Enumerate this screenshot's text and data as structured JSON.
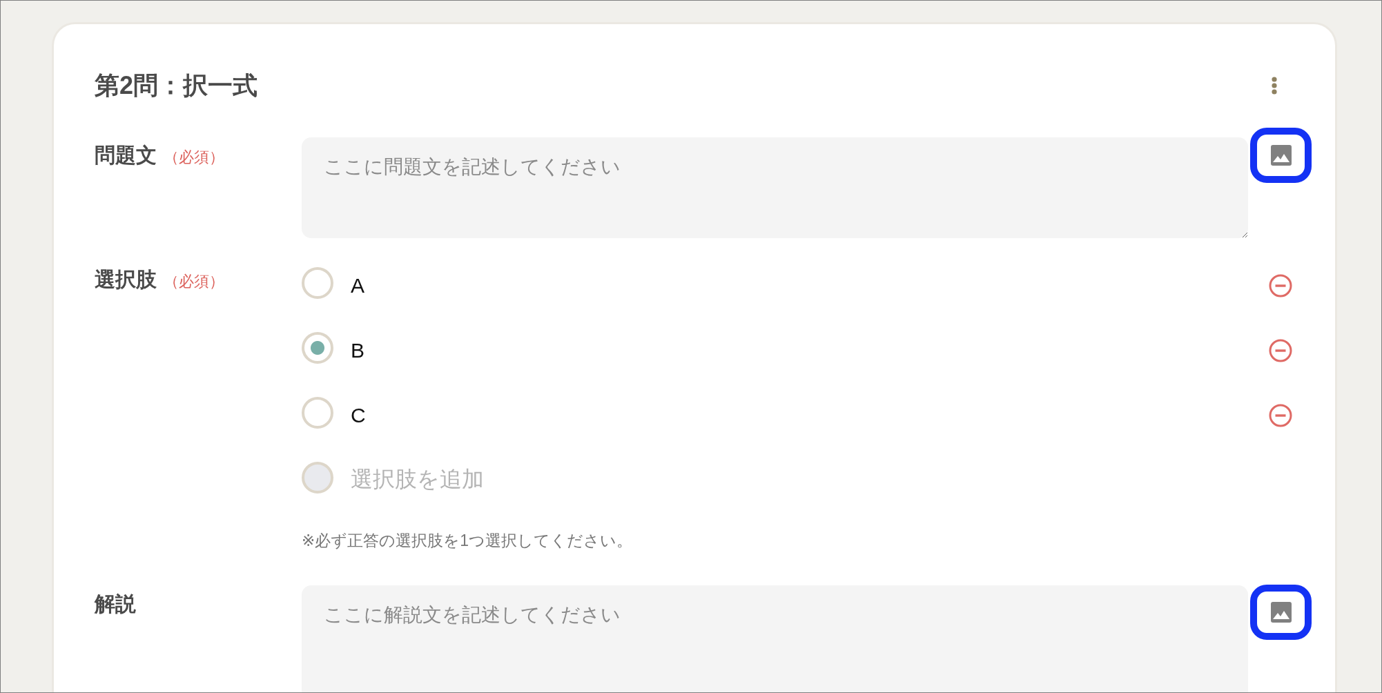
{
  "question": {
    "title": "第2問：択一式"
  },
  "sections": [
    {
      "kind": "text",
      "label": "問題文",
      "required_mark": "（必須）",
      "placeholder": "ここに問題文を記述してください"
    },
    {
      "kind": "choices",
      "label": "選択肢",
      "required_mark": "（必須）",
      "options": [
        {
          "label": "A",
          "selected": false
        },
        {
          "label": "B",
          "selected": true
        },
        {
          "label": "C",
          "selected": false
        }
      ],
      "add_option": "選択肢を追加",
      "note": "※必ず正答の選択肢を1つ選択してください。"
    },
    {
      "kind": "text",
      "label": "解説",
      "placeholder": "ここに解説文を記述してください"
    }
  ]
}
